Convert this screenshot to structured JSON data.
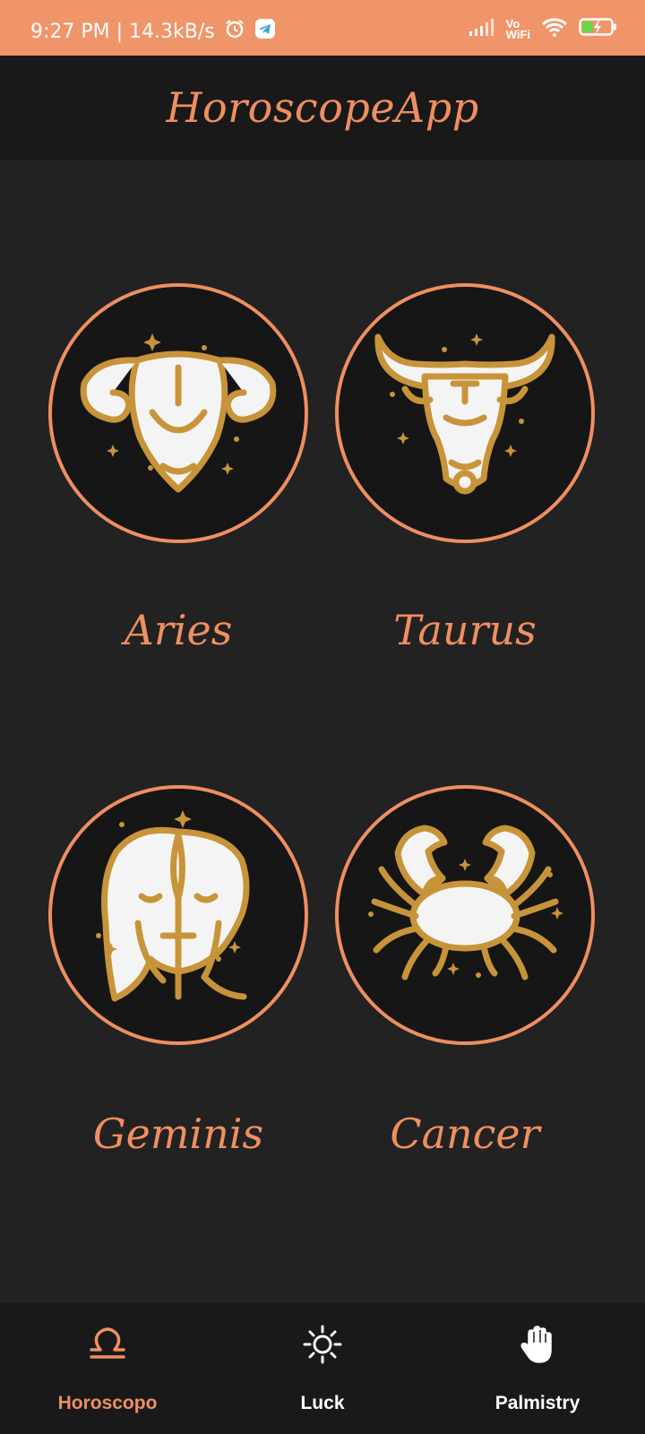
{
  "status_bar": {
    "time_speed": "9:27 PM | 14.3kB/s",
    "icons": [
      "alarm-icon",
      "telegram-icon",
      "signal-icon",
      "vowifi-icon",
      "wifi-icon",
      "battery-charging-icon"
    ],
    "vowifi_top": "Vo",
    "vowifi_bottom": "WiFi"
  },
  "app": {
    "title": "HoroscopeApp"
  },
  "signs": [
    {
      "name": "Aries",
      "icon": "aries-ram-icon"
    },
    {
      "name": "Taurus",
      "icon": "taurus-bull-icon"
    },
    {
      "name": "Geminis",
      "icon": "gemini-face-icon"
    },
    {
      "name": "Cancer",
      "icon": "cancer-crab-icon"
    }
  ],
  "nav": {
    "items": [
      {
        "label": "Horoscopo",
        "icon": "libra-icon",
        "active": true
      },
      {
        "label": "Luck",
        "icon": "sun-icon",
        "active": false
      },
      {
        "label": "Palmistry",
        "icon": "hand-icon",
        "active": false
      }
    ]
  },
  "colors": {
    "accent": "#ef8f60",
    "status_bar": "#f0956a",
    "background": "#222222",
    "bar": "#191919",
    "gold": "#c8943a",
    "circle_fill": "#161616"
  }
}
